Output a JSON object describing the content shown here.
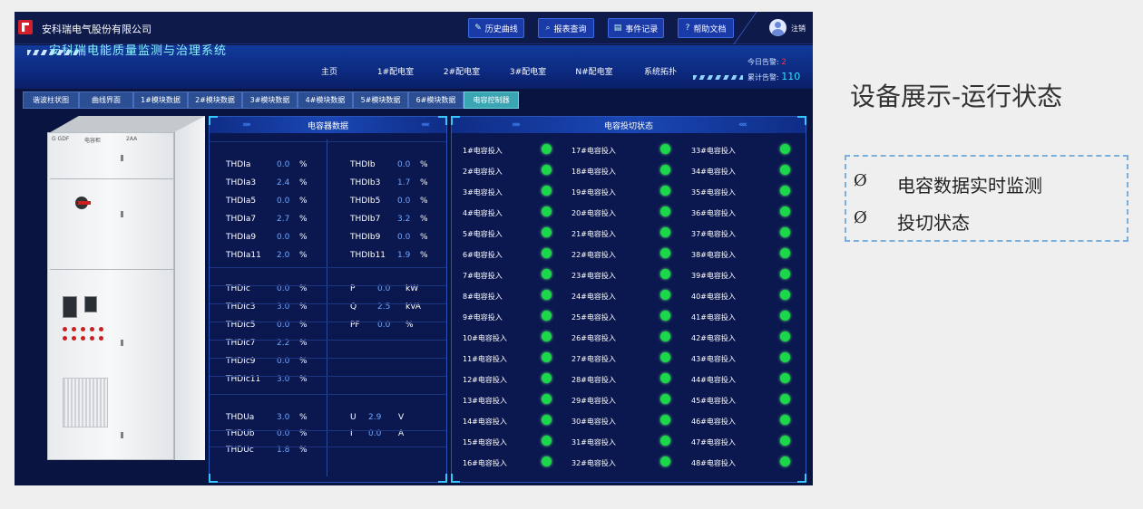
{
  "app": {
    "company": "安科瑞电气股份有限公司",
    "title": "安科瑞电能质量监测与治理系统",
    "logout": "注销"
  },
  "toolbar": [
    {
      "label": "历史曲线",
      "icon": "edit-icon"
    },
    {
      "label": "报表查询",
      "icon": "search-icon"
    },
    {
      "label": "事件记录",
      "icon": "document-icon"
    },
    {
      "label": "帮助文档",
      "icon": "help-icon"
    }
  ],
  "nav_tabs": [
    "主页",
    "1#配电室",
    "2#配电室",
    "3#配电室",
    "N#配电室",
    "系统拓扑"
  ],
  "alerts": {
    "today_label": "今日告警:",
    "today_value": "2",
    "total_label": "累计告警:",
    "total_value": "110"
  },
  "module_tabs": [
    "谐波柱状图",
    "曲线界面",
    "1#模块数据",
    "2#模块数据",
    "3#模块数据",
    "4#模块数据",
    "5#模块数据",
    "6#模块数据",
    "电容控制器"
  ],
  "active_module_tab": "电容控制器",
  "cabinet": {
    "label_left": "G GDF",
    "label_mid": "电容柜",
    "label_right": "2AA"
  },
  "capacitor_data": {
    "title": "电容器数据",
    "left_a": [
      {
        "label": "THDIa",
        "value": "0.0",
        "unit": "%"
      },
      {
        "label": "THDIa3",
        "value": "2.4",
        "unit": "%"
      },
      {
        "label": "THDIa5",
        "value": "0.0",
        "unit": "%"
      },
      {
        "label": "THDIa7",
        "value": "2.7",
        "unit": "%"
      },
      {
        "label": "THDIa9",
        "value": "0.0",
        "unit": "%"
      },
      {
        "label": "THDIa11",
        "value": "2.0",
        "unit": "%"
      }
    ],
    "right_b": [
      {
        "label": "THDIb",
        "value": "0.0",
        "unit": "%"
      },
      {
        "label": "THDIb3",
        "value": "1.7",
        "unit": "%"
      },
      {
        "label": "THDIb5",
        "value": "0.0",
        "unit": "%"
      },
      {
        "label": "THDIb7",
        "value": "3.2",
        "unit": "%"
      },
      {
        "label": "THDIb9",
        "value": "0.0",
        "unit": "%"
      },
      {
        "label": "THDIb11",
        "value": "1.9",
        "unit": "%"
      }
    ],
    "left_c": [
      {
        "label": "THDIc",
        "value": "0.0",
        "unit": "%"
      },
      {
        "label": "THDIc3",
        "value": "3.0",
        "unit": "%"
      },
      {
        "label": "THDIc5",
        "value": "0.0",
        "unit": "%"
      },
      {
        "label": "THDIc7",
        "value": "2.2",
        "unit": "%"
      },
      {
        "label": "THDIc9",
        "value": "0.0",
        "unit": "%"
      },
      {
        "label": "THDIc11",
        "value": "3.0",
        "unit": "%"
      }
    ],
    "power": [
      {
        "label": "P",
        "value": "0.0",
        "unit": "kW"
      },
      {
        "label": "Q",
        "value": "2.5",
        "unit": "kVA"
      },
      {
        "label": "PF",
        "value": "0.0",
        "unit": "%"
      }
    ],
    "left_u": [
      {
        "label": "THDUa",
        "value": "3.0",
        "unit": "%"
      },
      {
        "label": "THDUb",
        "value": "0.0",
        "unit": "%"
      },
      {
        "label": "THDUc",
        "value": "1.8",
        "unit": "%"
      }
    ],
    "ui": [
      {
        "label": "U",
        "value": "2.9",
        "unit": "V"
      },
      {
        "label": "I",
        "value": "0.0",
        "unit": "A"
      }
    ]
  },
  "switch_status": {
    "title": "电容投切状态",
    "columns": [
      [
        "1#电容投入",
        "2#电容投入",
        "3#电容投入",
        "4#电容投入",
        "5#电容投入",
        "6#电容投入",
        "7#电容投入",
        "8#电容投入",
        "9#电容投入",
        "10#电容投入",
        "11#电容投入",
        "12#电容投入",
        "13#电容投入",
        "14#电容投入",
        "15#电容投入",
        "16#电容投入"
      ],
      [
        "17#电容投入",
        "18#电容投入",
        "19#电容投入",
        "20#电容投入",
        "21#电容投入",
        "22#电容投入",
        "23#电容投入",
        "24#电容投入",
        "25#电容投入",
        "26#电容投入",
        "27#电容投入",
        "28#电容投入",
        "29#电容投入",
        "30#电容投入",
        "31#电容投入",
        "32#电容投入"
      ],
      [
        "33#电容投入",
        "34#电容投入",
        "35#电容投入",
        "36#电容投入",
        "37#电容投入",
        "38#电容投入",
        "39#电容投入",
        "40#电容投入",
        "41#电容投入",
        "42#电容投入",
        "43#电容投入",
        "44#电容投入",
        "45#电容投入",
        "46#电容投入",
        "47#电容投入",
        "48#电容投入"
      ]
    ],
    "led_color": "#1ad84a"
  },
  "slide": {
    "title": "设备展示-运行状态",
    "bullet_marker": "Ø",
    "bullets": [
      "电容数据实时监测",
      "投切状态"
    ]
  }
}
